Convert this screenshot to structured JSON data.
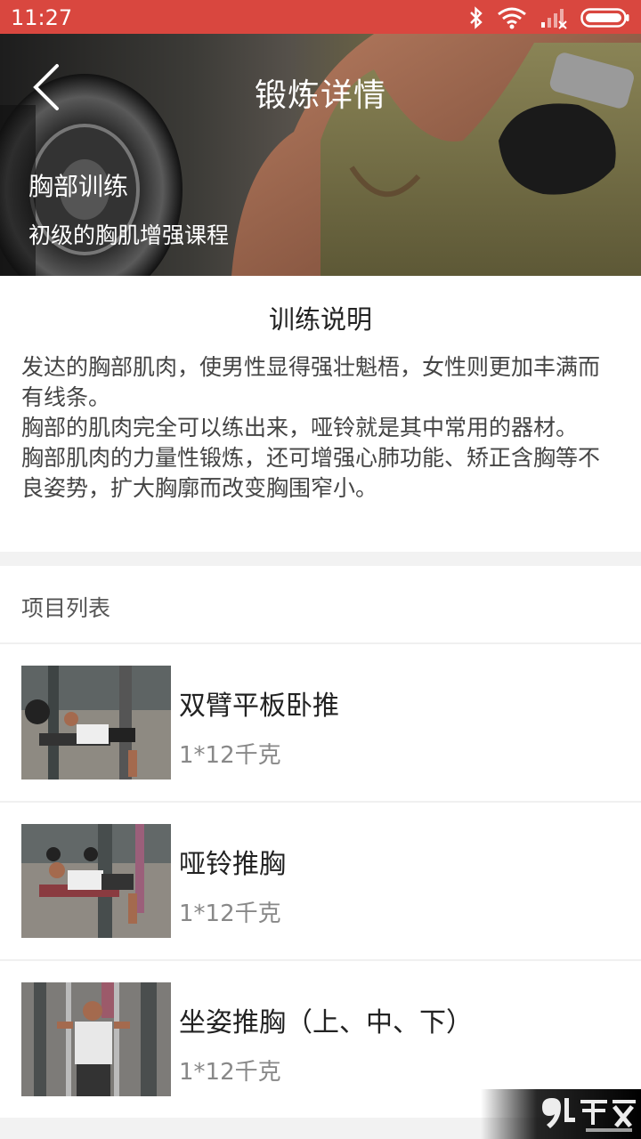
{
  "status_bar": {
    "time": "11:27",
    "icons": [
      "bluetooth-icon",
      "wifi-icon",
      "signal-icon",
      "battery-icon"
    ]
  },
  "header": {
    "title": "锻炼详情",
    "category": "胸部训练",
    "subtitle": "初级的胸肌增强课程"
  },
  "description": {
    "heading": "训练说明",
    "paragraphs": [
      "发达的胸部肌肉，使男性显得强壮魁梧，女性则更加丰满而有线条。",
      "胸部的肌肉完全可以练出来，哑铃就是其中常用的器材。",
      "胸部肌肉的力量性锻炼，还可增强心肺功能、矫正含胸等不良姿势，扩大胸廓而改变胸围窄小。"
    ]
  },
  "list": {
    "header": "项目列表",
    "items": [
      {
        "name": "双臂平板卧推",
        "quantity": "1*12千克"
      },
      {
        "name": "哑铃推胸",
        "quantity": "1*12千克"
      },
      {
        "name": "坐姿推胸（上、中、下）",
        "quantity": "1*12千克"
      }
    ]
  },
  "colors": {
    "status_bar": "#d9473f",
    "background": "#f2f2f2"
  }
}
